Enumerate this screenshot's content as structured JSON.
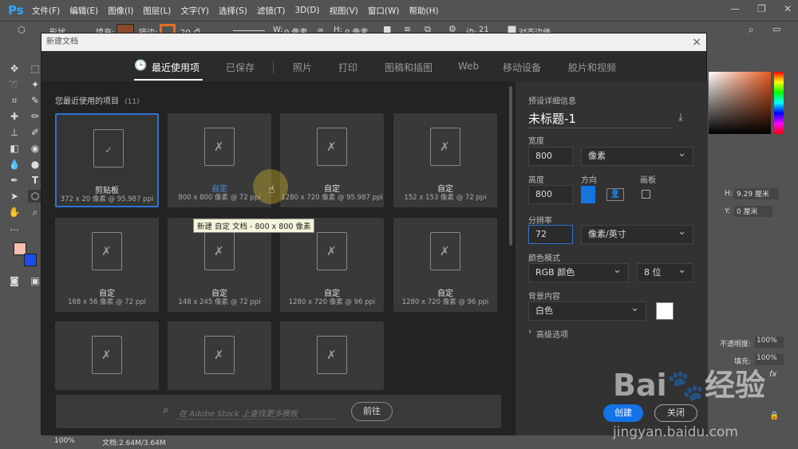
{
  "app": {
    "logo": "Ps"
  },
  "menu": [
    "文件(F)",
    "编辑(E)",
    "图像(I)",
    "图层(L)",
    "文字(Y)",
    "选择(S)",
    "滤镜(T)",
    "3D(D)",
    "视图(V)",
    "窗口(W)",
    "帮助(H)"
  ],
  "options": {
    "shape": "形状",
    "fill": "填充:",
    "stroke": "描边:",
    "stroke_size": "20 点",
    "w": "W:",
    "w_val": "0 像素",
    "h": "H:",
    "h_val": "0 像素",
    "edges": "边:",
    "edges_val": "21",
    "align": "对齐边缘"
  },
  "dialog": {
    "title": "新建文档",
    "tabs": [
      "最近使用项",
      "已保存",
      "照片",
      "打印",
      "图稿和插图",
      "Web",
      "移动设备",
      "胶片和视频"
    ],
    "recent_title": "您最近使用的项目",
    "recent_count": "(11)",
    "items": [
      {
        "name": "剪贴板",
        "info": "372 x 20 像素 @ 95.987 ppi"
      },
      {
        "name": "自定",
        "info": "800 x 800 像素 @ 72 ppi"
      },
      {
        "name": "自定",
        "info": "1280 x 720 像素 @ 95.987 ppi"
      },
      {
        "name": "自定",
        "info": "152 x 153 像素 @ 72 ppi"
      },
      {
        "name": "自定",
        "info": "168 x 56 像素 @ 72 ppi"
      },
      {
        "name": "自定",
        "info": "148 x 245 像素 @ 72 ppi"
      },
      {
        "name": "自定",
        "info": "1280 x 720 像素 @ 96 ppi"
      },
      {
        "name": "自定",
        "info": "1280 x 720 像素 @ 96 ppi"
      }
    ],
    "tooltip": "新建 自定 文档 - 800 x 800 像素",
    "search_placeholder": "在 Adobe Stock 上查找更多模板",
    "search_button": "前往",
    "preset": {
      "section": "预设详细信息",
      "name": "未标题-1",
      "width_label": "宽度",
      "width": "800",
      "width_unit": "像素",
      "height_label": "高度",
      "height": "800",
      "orientation_label": "方向",
      "artboard_label": "画板",
      "resolution_label": "分辨率",
      "resolution": "72",
      "resolution_unit": "像素/英寸",
      "color_mode_label": "颜色模式",
      "color_mode": "RGB 颜色",
      "bit_depth": "8 位",
      "bg_label": "背景内容",
      "bg": "白色",
      "advanced": "高级选项"
    },
    "create": "创建",
    "close": "关闭"
  },
  "panel": {
    "h_label": "H:",
    "h_val": "9.29 厘米",
    "y_label": "Y:",
    "y_val": "0 厘米",
    "opacity": "不透明度:",
    "opacity_val": "100%",
    "fill": "填充:",
    "fill_val": "100%"
  },
  "status": {
    "zoom": "100%",
    "doc": "文档:2.64M/3.64M"
  },
  "watermark": {
    "url": "jingyan.baidu.com"
  }
}
